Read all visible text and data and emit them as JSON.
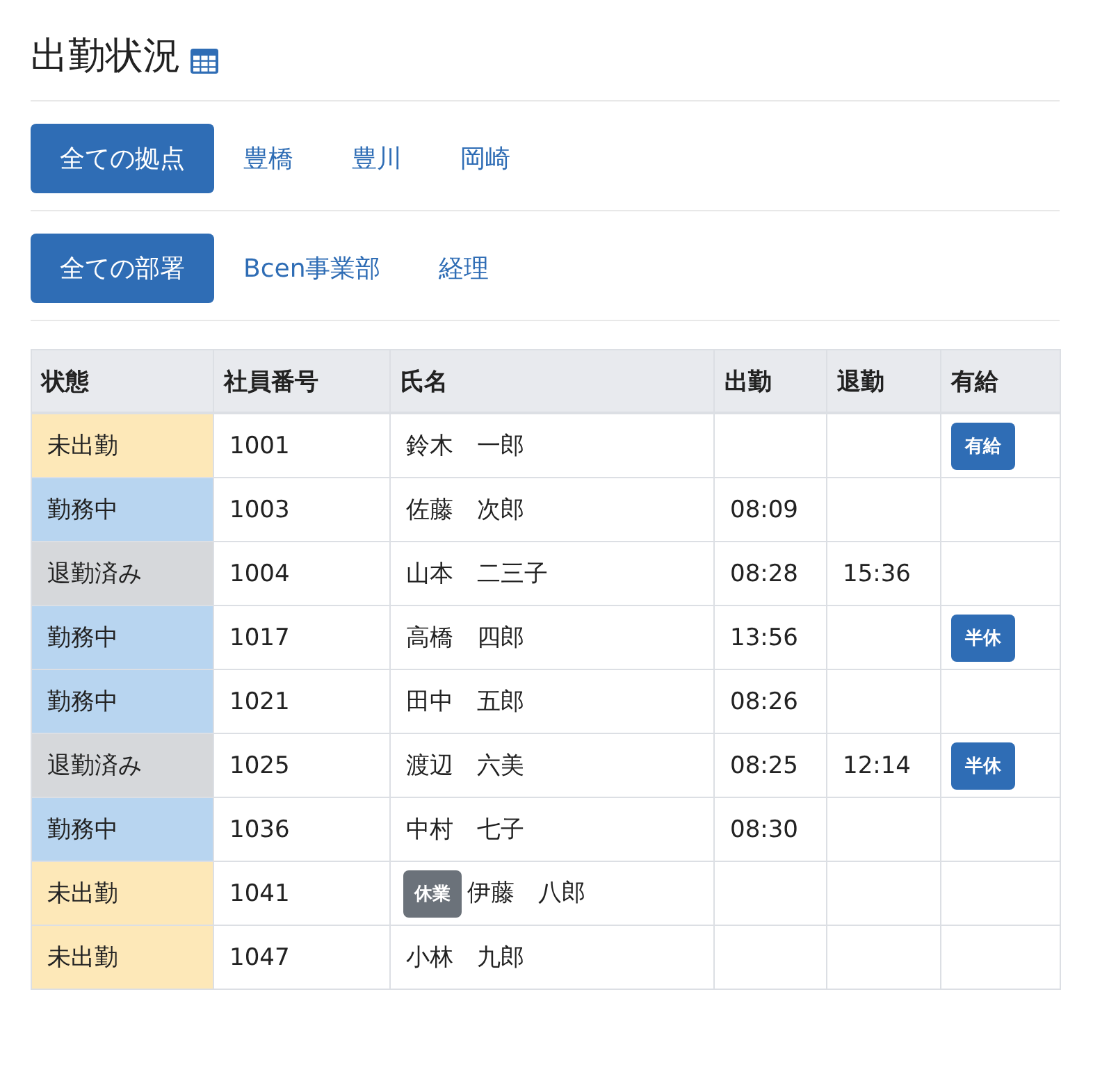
{
  "title": "出勤状況",
  "location_filters": [
    {
      "label": "全ての拠点",
      "selected": true
    },
    {
      "label": "豊橋",
      "selected": false
    },
    {
      "label": "豊川",
      "selected": false
    },
    {
      "label": "岡崎",
      "selected": false
    }
  ],
  "department_filters": [
    {
      "label": "全ての部署",
      "selected": true
    },
    {
      "label": "Bcen事業部",
      "selected": false
    },
    {
      "label": "経理",
      "selected": false
    }
  ],
  "table": {
    "columns": [
      "状態",
      "社員番号",
      "氏名",
      "出勤",
      "退勤",
      "有給"
    ],
    "rows": [
      {
        "status": {
          "label": "未出勤",
          "kind": "absent"
        },
        "id": "1001",
        "name": "鈴木　一郎",
        "leave": "有給"
      },
      {
        "status": {
          "label": "勤務中",
          "kind": "working"
        },
        "id": "1003",
        "name": "佐藤　次郎",
        "in": "08:09"
      },
      {
        "status": {
          "label": "退勤済み",
          "kind": "left"
        },
        "id": "1004",
        "name": "山本　二三子",
        "in": "08:28",
        "out": "15:36"
      },
      {
        "status": {
          "label": "勤務中",
          "kind": "working"
        },
        "id": "1017",
        "name": "高橋　四郎",
        "in": "13:56",
        "leave": "半休"
      },
      {
        "status": {
          "label": "勤務中",
          "kind": "working"
        },
        "id": "1021",
        "name": "田中　五郎",
        "in": "08:26"
      },
      {
        "status": {
          "label": "退勤済み",
          "kind": "left"
        },
        "id": "1025",
        "name": "渡辺　六美",
        "in": "08:25",
        "out": "12:14",
        "leave": "半休"
      },
      {
        "status": {
          "label": "勤務中",
          "kind": "working"
        },
        "id": "1036",
        "name": "中村　七子",
        "in": "08:30"
      },
      {
        "status": {
          "label": "未出勤",
          "kind": "absent"
        },
        "id": "1041",
        "name_badge": "休業",
        "name": "伊藤　八郎"
      },
      {
        "status": {
          "label": "未出勤",
          "kind": "absent"
        },
        "id": "1047",
        "name": "小林　九郎"
      }
    ]
  }
}
